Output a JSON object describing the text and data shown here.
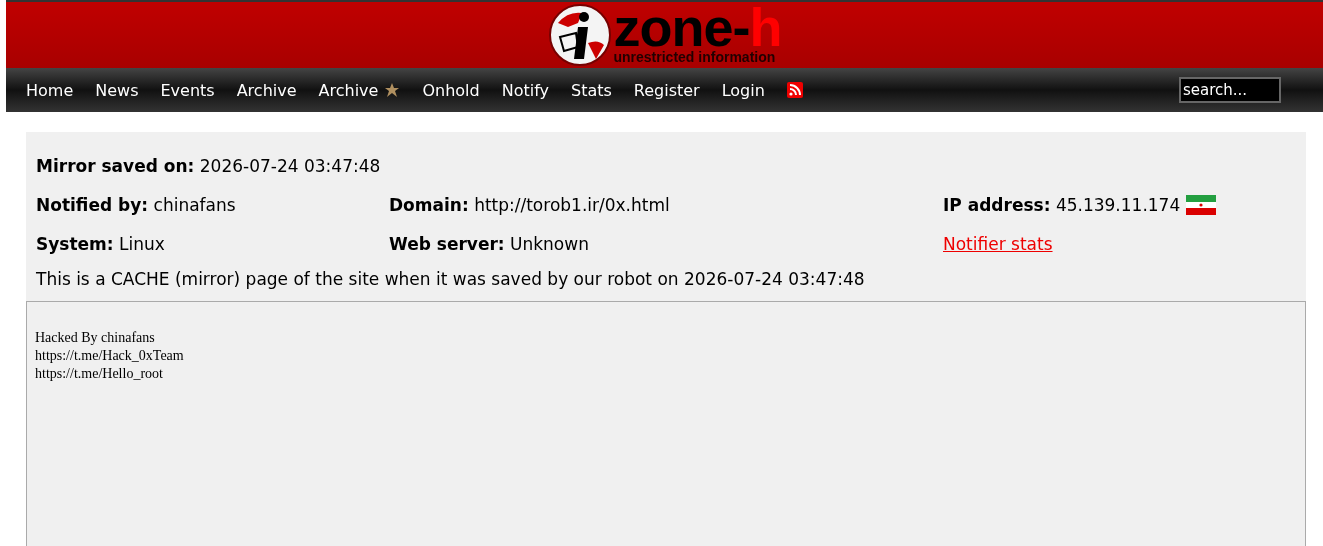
{
  "logo": {
    "name": "zone-",
    "accent": "h",
    "tagline": "unrestricted information"
  },
  "nav": {
    "items": [
      {
        "label": "Home",
        "kind": "plain"
      },
      {
        "label": "News",
        "kind": "plain"
      },
      {
        "label": "Events",
        "kind": "plain"
      },
      {
        "label": "Archive",
        "kind": "plain"
      },
      {
        "label": "Archive",
        "kind": "star"
      },
      {
        "label": "Onhold",
        "kind": "plain"
      },
      {
        "label": "Notify",
        "kind": "plain"
      },
      {
        "label": "Stats",
        "kind": "plain"
      },
      {
        "label": "Register",
        "kind": "plain"
      },
      {
        "label": "Login",
        "kind": "plain"
      },
      {
        "kind": "rss"
      }
    ],
    "search": {
      "value": "search..."
    }
  },
  "info": {
    "mirror_saved": {
      "label": "Mirror saved on:",
      "value": "2026-07-24 03:47:48"
    },
    "notified_by": {
      "label": "Notified by:",
      "value": "chinafans"
    },
    "domain": {
      "label": "Domain:",
      "value": "http://torob1.ir/0x.html"
    },
    "ip_address": {
      "label": "IP address:",
      "value": "45.139.11.174"
    },
    "system": {
      "label": "System:",
      "value": "Linux"
    },
    "web_server": {
      "label": "Web server:",
      "value": "Unknown"
    },
    "notifier_stats": "Notifier stats",
    "note": "This is a CACHE (mirror) page of the site when it was saved by our robot on 2026-07-24 03:47:48"
  },
  "mirror": {
    "lines": [
      "Hacked By chinafans",
      "https://t.me/Hack_0xTeam",
      "https://t.me/Hello_root"
    ]
  }
}
